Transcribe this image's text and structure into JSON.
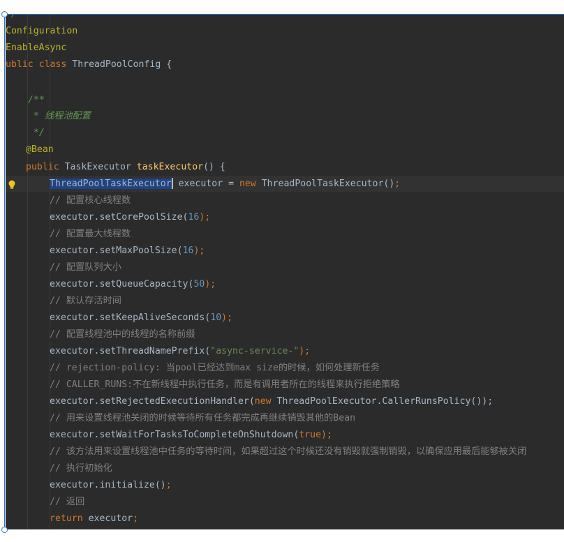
{
  "colors": {
    "background": "#2b2b2b",
    "keyword": "#cc7832",
    "annotation": "#bbb529",
    "doc_comment": "#629755",
    "comment": "#808080",
    "method": "#ffc66d",
    "number": "#6897bb",
    "string": "#6a8759",
    "default_text": "#a9b7c6"
  },
  "icons": {
    "gutter": "lightbulb-icon"
  },
  "code": {
    "l0_text": "*/",
    "l1_text": "Configuration",
    "l2_text": "EnableAsync",
    "l3_kw": "ublic class",
    "l3_rest": " ThreadPoolConfig {",
    "l5_text": "/**",
    "l6_text": " * 线程池配置",
    "l7_text": " */",
    "l8_text": "@Bean",
    "l9_kw": "public",
    "l9_type": " TaskExecutor ",
    "l9_fn": "taskExecutor",
    "l9_rest": "() {",
    "l10_sel": "ThreadPoolTaskExecutor",
    "l10_mid": " executor = ",
    "l10_kw": "new",
    "l10_rest": " ThreadPoolTaskExecutor()",
    "l10_semi": ";",
    "l11_text": "// 配置核心线程数",
    "l12_a": "executor.setCorePoolSize(",
    "l12_num": "16",
    "l12_b": ");",
    "l13_text": "// 配置最大线程数",
    "l14_a": "executor.setMaxPoolSize(",
    "l14_num": "16",
    "l14_b": ");",
    "l15_text": "// 配置队列大小",
    "l16_a": "executor.setQueueCapacity(",
    "l16_num": "50",
    "l16_b": ");",
    "l17_text": "// 默认存活时间",
    "l18_a": "executor.setKeepAliveSeconds(",
    "l18_num": "10",
    "l18_b": ");",
    "l19_text": "// 配置线程池中的线程的名称前缀",
    "l20_a": "executor.setThreadNamePrefix(",
    "l20_str": "\"async-service-\"",
    "l20_b": ");",
    "l21_text": "// rejection-policy: 当pool已经达到max size的时候，如何处理新任务",
    "l22_text": "// CALLER_RUNS:不在新线程中执行任务，而是有调用者所在的线程来执行拒绝策略",
    "l23_a": "executor.setRejectedExecutionHandler(",
    "l23_kw": "new",
    "l23_b": " ThreadPoolExecutor.CallerRunsPolicy());",
    "l24_text": "// 用来设置线程池关闭的时候等待所有任务都完成再继续销毁其他的Bean",
    "l25_a": "executor.setWaitForTasksToCompleteOnShutdown(",
    "l25_kw": "true",
    "l25_b": ");",
    "l26_text": "// 该方法用来设置线程池中任务的等待时间，如果超过这个时候还没有销毁就强制销毁，以确保应用最后能够被关闭",
    "l27_text": "// 执行初始化",
    "l28_a": "executor.initialize()",
    "l28_b": ";",
    "l29_text": "// 返回",
    "l30_kw": "return",
    "l30_b": " executor",
    "l30_c": ";"
  }
}
